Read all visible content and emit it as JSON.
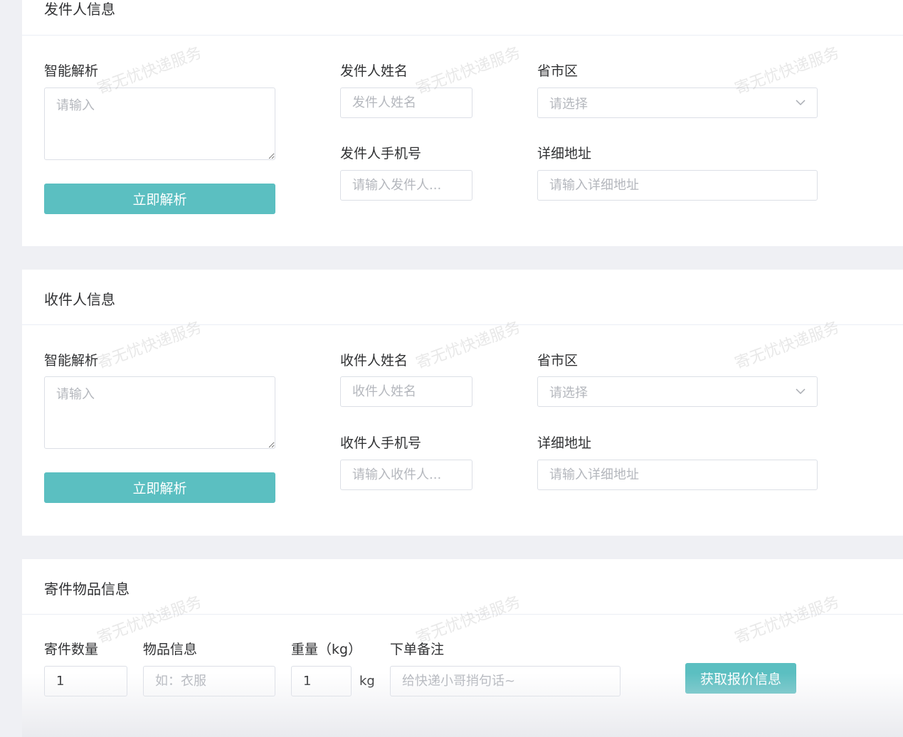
{
  "sender": {
    "title": "发件人信息",
    "smart_label": "智能解析",
    "smart_placeholder": "请输入",
    "parse_button": "立即解析",
    "name_label": "发件人姓名",
    "name_placeholder": "发件人姓名",
    "phone_label": "发件人手机号",
    "phone_placeholder": "请输入发件人...",
    "region_label": "省市区",
    "region_placeholder": "请选择",
    "address_label": "详细地址",
    "address_placeholder": "请输入详细地址"
  },
  "recipient": {
    "title": "收件人信息",
    "smart_label": "智能解析",
    "smart_placeholder": "请输入",
    "parse_button": "立即解析",
    "name_label": "收件人姓名",
    "name_placeholder": "收件人姓名",
    "phone_label": "收件人手机号",
    "phone_placeholder": "请输入收件人...",
    "region_label": "省市区",
    "region_placeholder": "请选择",
    "address_label": "详细地址",
    "address_placeholder": "请输入详细地址"
  },
  "items": {
    "title": "寄件物品信息",
    "quantity_label": "寄件数量",
    "quantity_value": "1",
    "goods_label": "物品信息",
    "goods_placeholder": "如：衣服",
    "weight_label": "重量（kg）",
    "weight_value": "1",
    "weight_unit": "kg",
    "remark_label": "下单备注",
    "remark_placeholder": "给快递小哥捎句话~",
    "quote_button": "获取报价信息"
  },
  "watermark": "寄无忧快递服务",
  "colors": {
    "accent": "#5bbfc1",
    "page_bg": "#eff0f4",
    "card_bg": "#ffffff",
    "border": "#dcdfe6",
    "placeholder": "#b4b7bd"
  },
  "icons": {
    "dropdown": "chevron-down-icon"
  }
}
